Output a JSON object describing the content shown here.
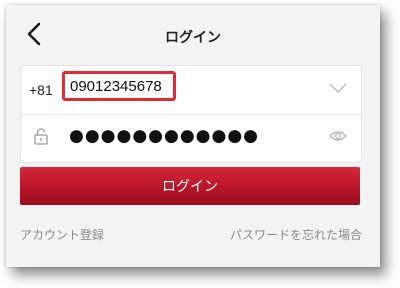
{
  "header": {
    "title": "ログイン",
    "back_icon": "chevron-left-icon"
  },
  "form": {
    "country_code": "+81",
    "phone_value": "09012345678",
    "country_dropdown_icon": "chevron-down-icon",
    "password_icon": "lock-icon",
    "password_masked": "●●●●●●●●●●●●",
    "visibility_icon": "eye-icon"
  },
  "actions": {
    "login_label": "ログイン",
    "register_label": "アカウント登録",
    "forgot_label": "パスワードを忘れた場合"
  },
  "colors": {
    "accent_red": "#c01a2e",
    "highlight_border": "#e02c37",
    "background": "#f3f3f3",
    "link_gray": "#8a8a8a"
  }
}
